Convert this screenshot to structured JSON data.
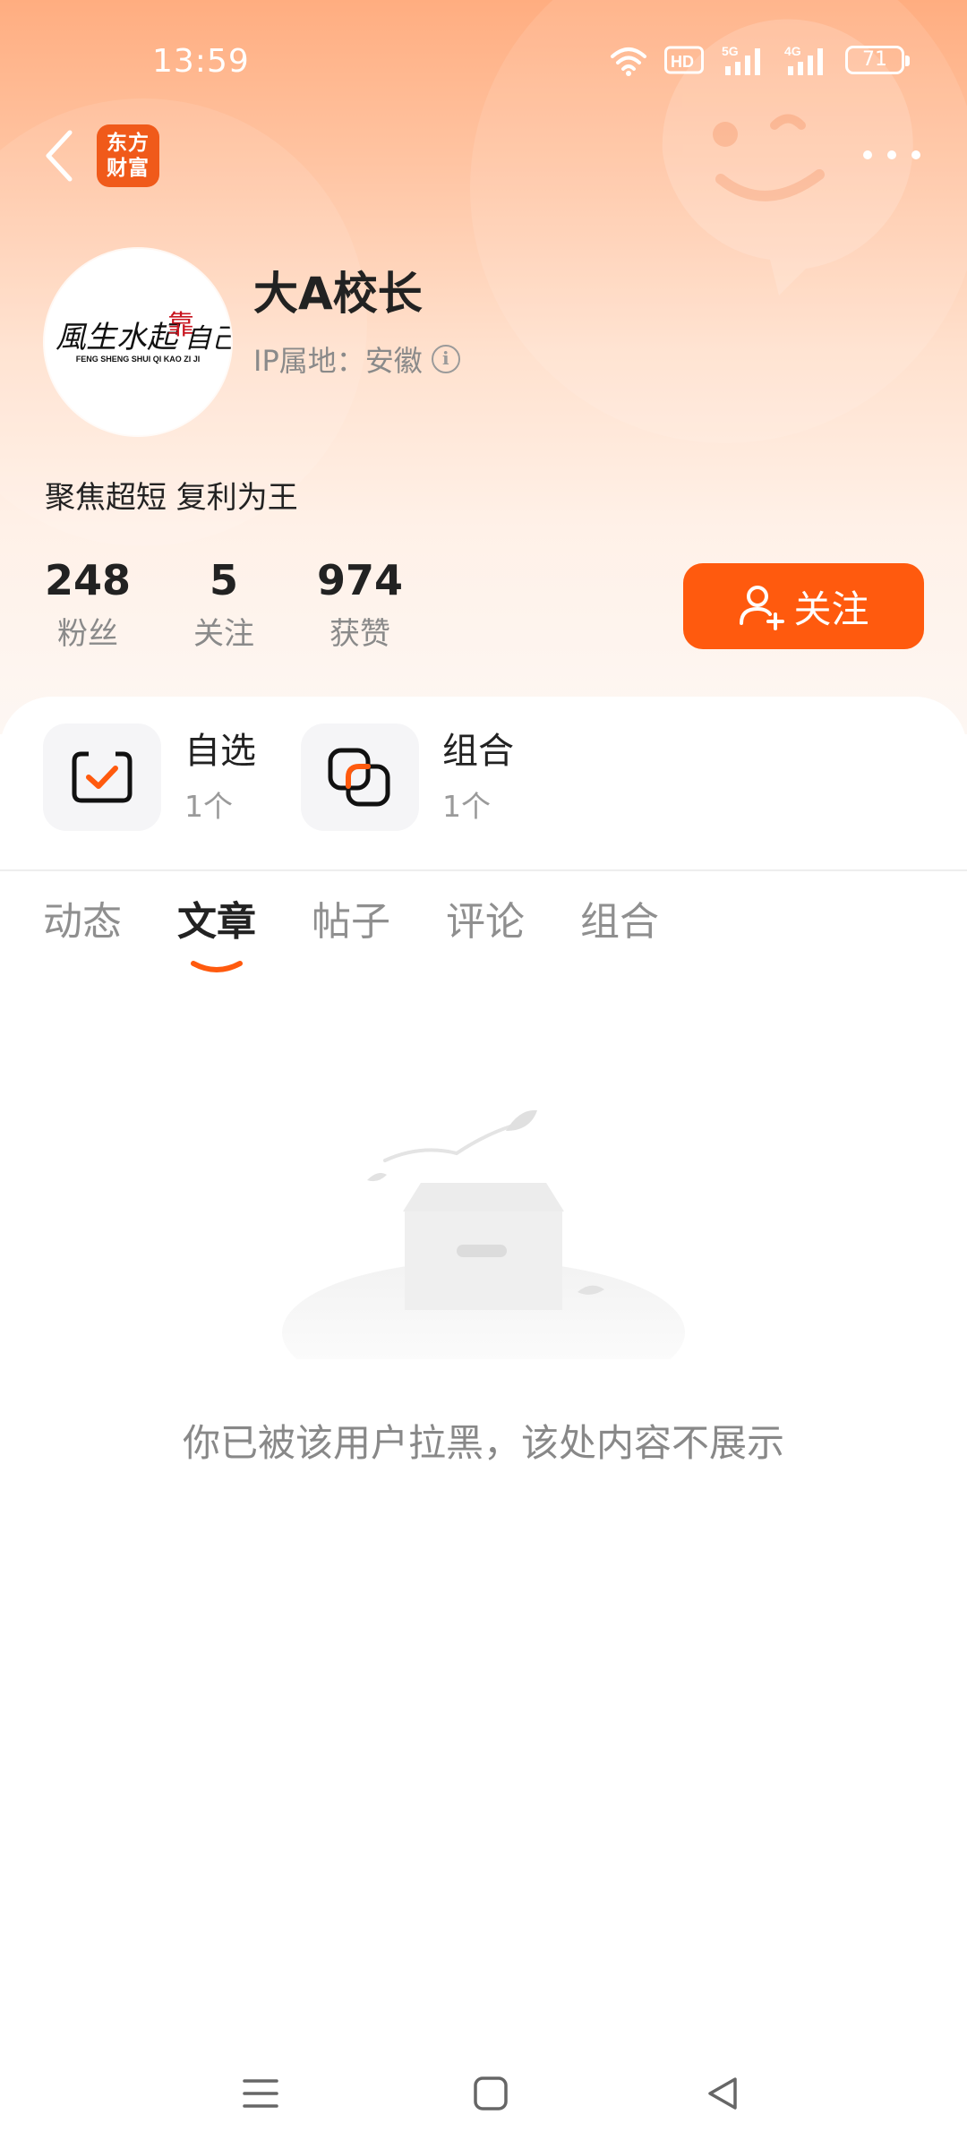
{
  "status_bar": {
    "time": "13:59",
    "hd_label": "HD",
    "net1_label": "5G",
    "net2_label": "4G",
    "battery": "71"
  },
  "app": {
    "logo_line1": "东方",
    "logo_line2": "财富"
  },
  "profile": {
    "name": "大A校长",
    "ip_location": "IP属地：安徽",
    "bio": "聚焦超短 复利为王",
    "avatar_text_main": "風生水起",
    "avatar_text_accent": "靠",
    "avatar_text_tail": "自己",
    "avatar_text_latin": "FENG SHENG SHUI QI KAO ZI JI"
  },
  "stats": [
    {
      "value": "248",
      "label": "粉丝"
    },
    {
      "value": "5",
      "label": "关注"
    },
    {
      "value": "974",
      "label": "获赞"
    }
  ],
  "follow_button": {
    "label": "关注"
  },
  "shortcuts": [
    {
      "title": "自选",
      "count": "1个",
      "icon": "checkbox-icon"
    },
    {
      "title": "组合",
      "count": "1个",
      "icon": "overlap-squares-icon"
    }
  ],
  "tabs": [
    {
      "label": "动态",
      "active": false
    },
    {
      "label": "文章",
      "active": true
    },
    {
      "label": "帖子",
      "active": false
    },
    {
      "label": "评论",
      "active": false
    },
    {
      "label": "组合",
      "active": false
    }
  ],
  "empty_state": {
    "message": "你已被该用户拉黑，该处内容不展示"
  },
  "colors": {
    "accent": "#ff5a0e",
    "logo_bg": "#f05a1a",
    "hero_top": "#ffad80"
  }
}
